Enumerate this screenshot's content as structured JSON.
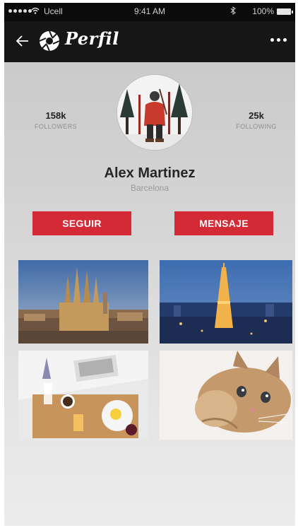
{
  "status_bar": {
    "carrier": "Ucell",
    "time": "9:41 AM",
    "battery": "100%"
  },
  "navbar": {
    "title": "Perfil",
    "back_icon": "arrow-left-icon",
    "menu_icon": "more-horizontal-icon"
  },
  "profile": {
    "name": "Alex Martinez",
    "location": "Barcelona",
    "followers": {
      "value": "158k",
      "label": "FOLLOWERS"
    },
    "following": {
      "value": "25k",
      "label": "FOLLOWING"
    }
  },
  "actions": {
    "follow_label": "SEGUIR",
    "message_label": "MENSAJE"
  },
  "gallery": [
    {
      "name": "sagrada-familia"
    },
    {
      "name": "eiffel-tower-night"
    },
    {
      "name": "breakfast-tray"
    },
    {
      "name": "kitten"
    }
  ],
  "colors": {
    "accent": "#d42a35",
    "navbar": "#161616"
  }
}
